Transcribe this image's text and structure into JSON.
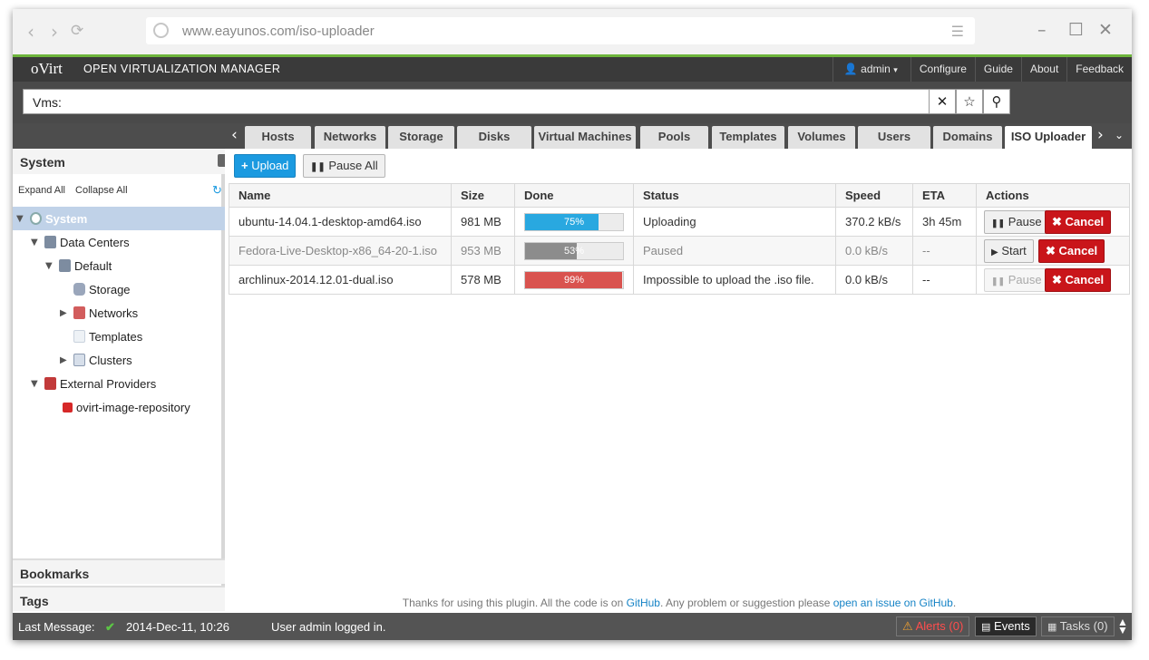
{
  "browser": {
    "url": "www.eayunos.com/iso-uploader"
  },
  "header": {
    "logo": "oVirt",
    "product": "OPEN VIRTUALIZATION MANAGER",
    "user": "admin",
    "links": [
      "Configure",
      "Guide",
      "About",
      "Feedback"
    ]
  },
  "search": {
    "value": "Vms:"
  },
  "tabs": [
    "Hosts",
    "Networks",
    "Storage",
    "Disks",
    "Virtual Machines",
    "Pools",
    "Templates",
    "Volumes",
    "Users",
    "Domains",
    "ISO Uploader"
  ],
  "active_tab": "ISO Uploader",
  "left": {
    "title": "System",
    "expand_all": "Expand All",
    "collapse_all": "Collapse All",
    "tree": {
      "system": "System",
      "data_centers": "Data Centers",
      "default": "Default",
      "storage": "Storage",
      "networks": "Networks",
      "templates": "Templates",
      "clusters": "Clusters",
      "external_providers": "External Providers",
      "repo": "ovirt-image-repository"
    },
    "bookmarks": "Bookmarks",
    "tags": "Tags"
  },
  "toolbar": {
    "upload": "Upload",
    "pause_all": "Pause All"
  },
  "table": {
    "headers": [
      "Name",
      "Size",
      "Done",
      "Status",
      "Speed",
      "ETA",
      "Actions"
    ],
    "rows": [
      {
        "name": "ubuntu-14.04.1-desktop-amd64.iso",
        "size": "981 MB",
        "done": "75%",
        "status": "Uploading",
        "speed": "370.2 kB/s",
        "eta": "3h 45m",
        "action1": "Pause",
        "action2": "Cancel"
      },
      {
        "name": "Fedora-Live-Desktop-x86_64-20-1.iso",
        "size": "953 MB",
        "done": "53%",
        "status": "Paused",
        "speed": "0.0 kB/s",
        "eta": "--",
        "action1": "Start",
        "action2": "Cancel"
      },
      {
        "name": "archlinux-2014.12.01-dual.iso",
        "size": "578 MB",
        "done": "99%",
        "status": "Impossible to upload the .iso file.",
        "speed": "0.0 kB/s",
        "eta": "--",
        "action1": "Pause",
        "action2": "Cancel"
      }
    ]
  },
  "footnote": {
    "prefix": "Thanks for using this plugin. All the code is on ",
    "link1": "GitHub",
    "middle": ". Any problem or suggestion please ",
    "link2": "open an issue on GitHub",
    "suffix": "."
  },
  "statusbar": {
    "last_message_label": "Last Message:",
    "timestamp": "2014-Dec-11, 10:26",
    "message": "User admin logged in.",
    "alerts": "Alerts (0)",
    "events": "Events",
    "tasks": "Tasks (0)"
  },
  "colors": {
    "progress_uploading": "#29a8e0",
    "progress_paused": "#8c8c8c",
    "progress_error": "#d9534f",
    "brand_green": "#6eb53c"
  }
}
